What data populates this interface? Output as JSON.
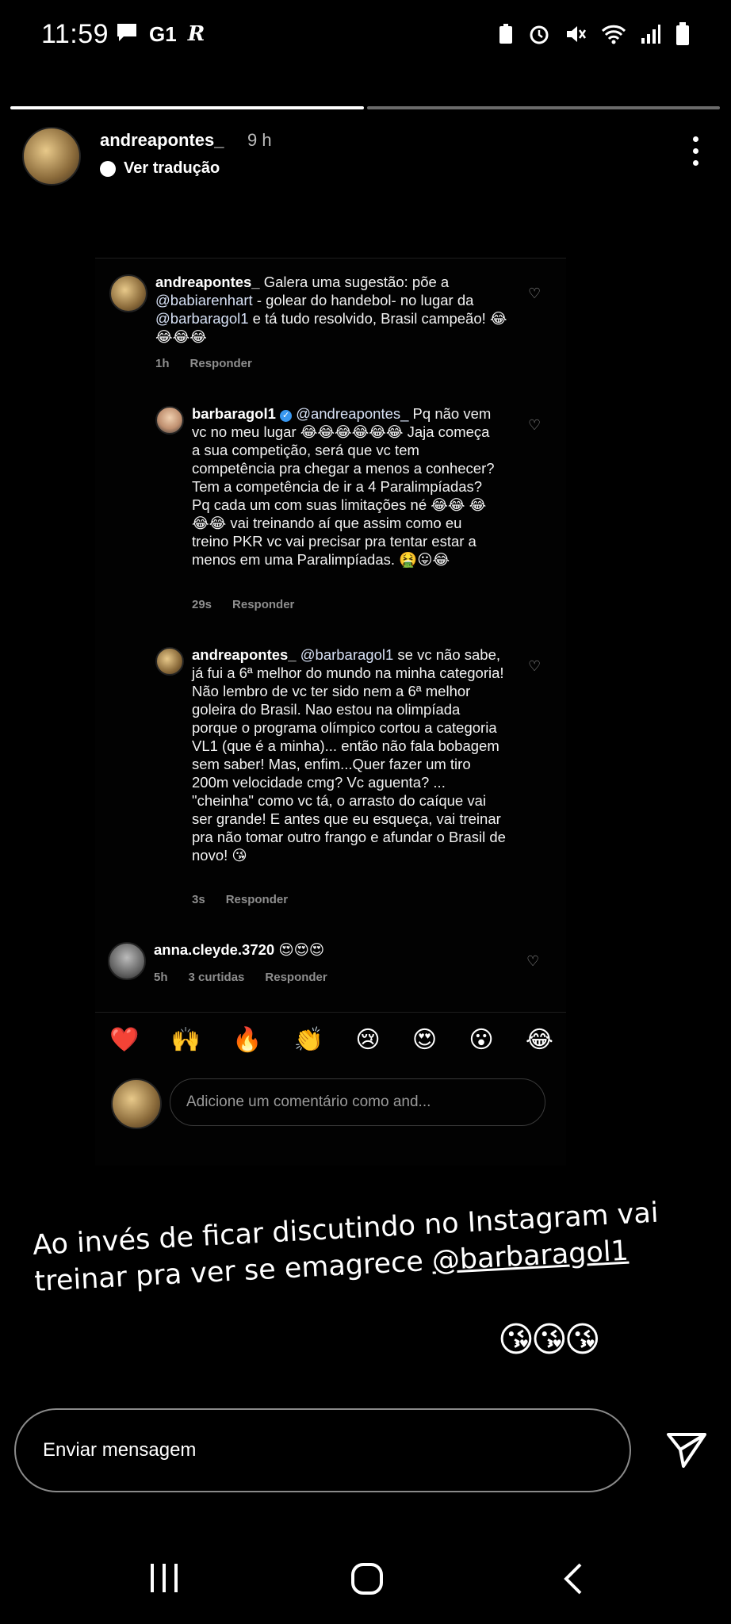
{
  "status_bar": {
    "time": "11:59",
    "left_icons": [
      "message-icon",
      "g1-icon",
      "r-icon"
    ],
    "left_labels": [
      "G1",
      "R"
    ],
    "right_icons": [
      "battery-saver-icon",
      "alarm-icon",
      "mute-icon",
      "wifi-icon",
      "signal-icon",
      "battery-icon"
    ]
  },
  "story": {
    "progress": [
      1.0,
      0.0
    ],
    "username": "andreapontes_",
    "time_ago": "9 h",
    "translate_label": "Ver tradução"
  },
  "comments": [
    {
      "user": "andreapontes_",
      "text_before": "Galera uma sugestão: põe a",
      "mention1": "@babiarenhart",
      "text_mid": "- golear do handebol- no lugar da",
      "mention2": "@barbaragol1",
      "text_after": "e tá tudo resolvido, Brasil campeão! 😂😂😂😂",
      "time": "1h",
      "reply_label": "Responder"
    },
    {
      "user": "barbaragol1",
      "mention": "@andreapontes_",
      "text": "Pq não vem vc no meu lugar 😂😂😂😂😂😂 Jaja começa a sua competição, será que vc tem competência pra chegar a menos a conhecer? Tem a competência de ir a 4 Paralimpíadas? Pq cada um com suas limitações né 😂😂 😂😂😂 vai treinando aí que assim como eu treino PKR vc vai precisar pra tentar estar a menos em uma Paralimpíadas. 🤮😛😂",
      "time": "29s",
      "reply_label": "Responder"
    },
    {
      "user": "andreapontes_",
      "mention": "@barbaragol1",
      "text": "se vc não sabe, já fui a 6ª melhor do mundo na minha categoria! Não lembro de vc ter sido nem a 6ª melhor goleira do Brasil. Nao estou na olimpíada porque o programa olímpico cortou a categoria VL1 (que é a minha)... então não fala bobagem sem saber! Mas, enfim...Quer fazer um tiro 200m velocidade cmg? Vc aguenta? ... \"cheinha\" como vc tá, o arrasto do caíque vai ser grande! E antes que eu esqueça, vai treinar pra não tomar outro frango e afundar o Brasil de novo! 😘",
      "time": "3s",
      "reply_label": "Responder"
    },
    {
      "user": "anna.cleyde.3720",
      "text": "😍😍😍",
      "time": "5h",
      "likes": "3 curtidas",
      "reply_label": "Responder"
    }
  ],
  "reactions": [
    "❤️",
    "🙌",
    "🔥",
    "👏",
    "😢",
    "😍",
    "😮",
    "😂"
  ],
  "add_comment_placeholder": "Adicione um comentário como and...",
  "caption": {
    "line1": "Ao invés de ficar discutindo no Instagram vai",
    "line2": "treinar pra ver se emagrece",
    "mention": "@barbaragol1",
    "emojis": "😘😘😘"
  },
  "reply_bar": {
    "placeholder": "Enviar mensagem"
  },
  "nav_bar": [
    "recent-apps-icon",
    "home-icon",
    "back-icon"
  ]
}
